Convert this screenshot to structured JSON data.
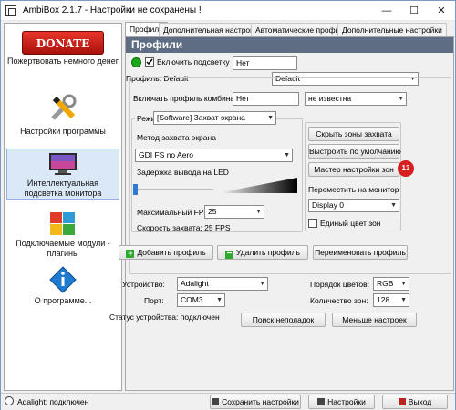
{
  "window": {
    "title": "AmbiBox 2.1.7  -  Настройки не сохранены !",
    "minimize": "—",
    "maximize": "☐",
    "close": "✕"
  },
  "sidebar": {
    "donate": "DONATE NOW",
    "items": [
      {
        "label": "Пожертвовать немного денег",
        "icon": "donate-icon"
      },
      {
        "label": "Настройки программы",
        "icon": "tools-icon"
      },
      {
        "label": "Интеллектуальная подсветка монитора",
        "icon": "monitor-icon"
      },
      {
        "label": "Подключаемые модули - плагины",
        "icon": "puzzle-icon"
      },
      {
        "label": "О программе...",
        "icon": "info-icon"
      }
    ]
  },
  "tabs": [
    "Профили",
    "Дополнительная настройка зон",
    "Автоматические профили",
    "Дополнительные настройки"
  ],
  "header": "Профили",
  "backlight": {
    "enable_label": "Включить подсветку",
    "value": "Нет",
    "checked": true,
    "status_color": "#1aa81a"
  },
  "profile": {
    "label": "Профиль: Default",
    "value": "Default"
  },
  "combo": {
    "label": "Включать профиль комбинацией:",
    "value": "Нет",
    "key": "не известна"
  },
  "mode": {
    "label": "Режим:",
    "value": "[Software] Захват экрана"
  },
  "capture": {
    "method_label": "Метод захвата экрана",
    "method": "GDI FS no Aero",
    "delay_label": "Задержка вывода на LED",
    "fps_label": "Максимальный FPS",
    "fps": "25",
    "speed": "Скорость захвата: 25 FPS"
  },
  "right_buttons": {
    "hide": "Скрыть зоны захвата",
    "align": "Выстроить по умолчанию",
    "wizard": "Мастер настройки зон",
    "badge": "13"
  },
  "monitor": {
    "label": "Переместить на монитор",
    "value": "Display 0",
    "single_label": "Единый цвет зон"
  },
  "profile_buttons": {
    "add": "Добавить профиль",
    "delete": "Удалить профиль",
    "rename": "Переименовать профиль"
  },
  "device": {
    "device_label": "Устройство:",
    "device": "Adalight",
    "port_label": "Порт:",
    "port": "COM3",
    "order_label": "Порядок цветов:",
    "order": "RGB",
    "zones_label": "Количество зон:",
    "zones": "128",
    "status": "Статус устройства: подключен",
    "search": "Поиск неполадок",
    "less": "Меньше настроек"
  },
  "statusbar": {
    "text": "Adalight: подключен",
    "save": "Сохранить настройки",
    "settings": "Настройки",
    "exit": "Выход"
  }
}
